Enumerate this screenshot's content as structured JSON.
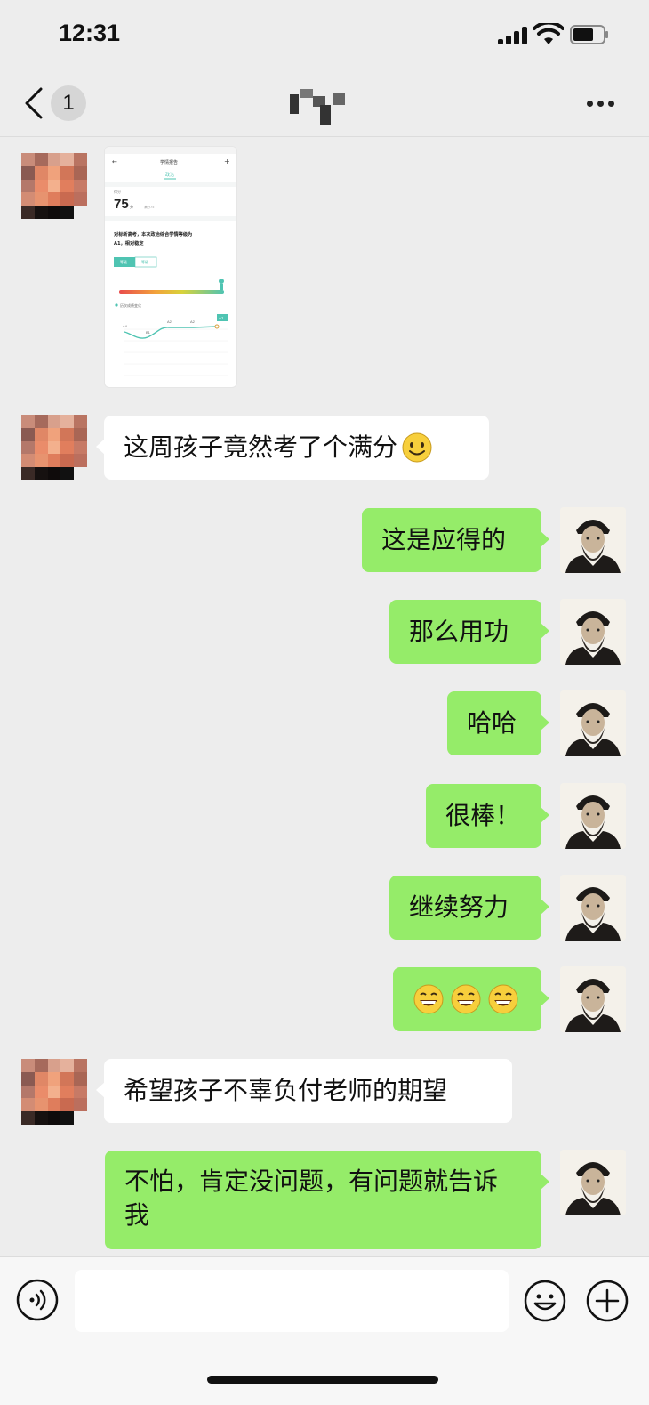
{
  "status_bar": {
    "time": "12:31"
  },
  "nav": {
    "unread_count": "1"
  },
  "report_image": {
    "header": "学情报告",
    "tab": "政治",
    "score_label": "得分",
    "score": "75",
    "score_unit": "分",
    "full_score": "满分75",
    "summary_line1": "对标新高考，本次政治综合学情等级为",
    "summary_line2": "A1，相对稳定",
    "toggle": [
      "等级",
      "等级"
    ],
    "legend": "历次成绩变化",
    "level_badge": "A1",
    "chart_labels": [
      "A4",
      "B1",
      "A2",
      "A2"
    ]
  },
  "messages": [
    {
      "side": "left",
      "text": "这周孩子竟然考了个满分"
    },
    {
      "side": "right",
      "text": "这是应得的"
    },
    {
      "side": "right",
      "text": "那么用功"
    },
    {
      "side": "right",
      "text": "哈哈"
    },
    {
      "side": "right",
      "text": "很棒！"
    },
    {
      "side": "right",
      "text": "继续努力"
    },
    {
      "side": "right",
      "emoji": [
        "grinning-face",
        "grinning-face",
        "grinning-face"
      ]
    },
    {
      "side": "left",
      "text": "希望孩子不辜负付老师的期望"
    },
    {
      "side": "right",
      "text": "不怕，肯定没问题，有问题就告诉我"
    }
  ],
  "colors": {
    "background": "#ededed",
    "bubble_self": "#95ec69",
    "bubble_other": "#ffffff",
    "report_accent": "#4fc4b2"
  },
  "input_bar": {
    "placeholder": ""
  }
}
